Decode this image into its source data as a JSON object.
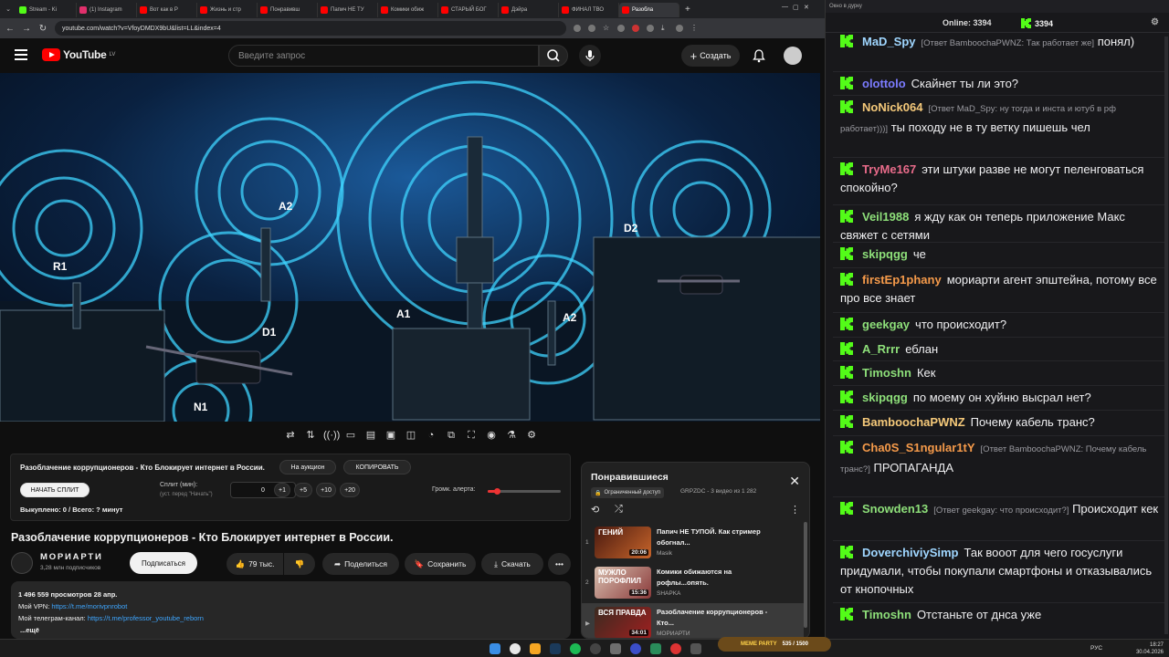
{
  "browser": {
    "tabs": [
      {
        "label": "Stream - Ki",
        "color": "#53fc18"
      },
      {
        "label": "(1) Instagram",
        "color": "#e1306c"
      },
      {
        "label": "Вот как в Р",
        "color": "#ff0000"
      },
      {
        "label": "Жизнь и стр",
        "color": "#ff0000"
      },
      {
        "label": "Понравивш",
        "color": "#ff0000"
      },
      {
        "label": "Папич НЕ ТУ",
        "color": "#ff0000"
      },
      {
        "label": "Комики обиж",
        "color": "#ff0000"
      },
      {
        "label": "СТАРЫЙ БОГ",
        "color": "#ff0000"
      },
      {
        "label": "Дэйра",
        "color": "#ff0000"
      },
      {
        "label": "ФИНАЛ ТВО",
        "color": "#ff0000"
      },
      {
        "label": "Разобла",
        "color": "#ff0000"
      }
    ],
    "url": "youtube.com/watch?v=VfoyDMDX9bU&list=LL&index=4"
  },
  "youtube": {
    "logo_text": "YouTube",
    "region": "LV",
    "search_placeholder": "Введите запрос",
    "create_label": "Создать",
    "video_labels": [
      "A2",
      "R1",
      "D1",
      "A1",
      "D2",
      "A2",
      "N1"
    ],
    "split_panel": {
      "title": "Разоблачение коррупционеров - Кто Блокирует интернет в России.",
      "auction_label": "На аукцион",
      "copy_label": "КОПИРОВАТЬ",
      "start_label": "НАЧАТЬ СПЛИТ",
      "split_label": "Сплит (мин):",
      "split_hint": "(уст. перед \"Начать\")",
      "split_value": "0",
      "increments": [
        "+1",
        "+5",
        "+10",
        "+20"
      ],
      "volume_label": "Громк. алерта:",
      "volume_level": 0.12,
      "status": "Выкуплено: 0 / Всего: ? минут"
    },
    "video_title": "Разоблачение коррупционеров - Кто Блокирует интернет в России.",
    "channel": {
      "name": "МОРИАРТИ",
      "subs": "3,28 млн подписчиков",
      "subscribe_label": "Подписаться"
    },
    "actions": {
      "likes": "79 тыс.",
      "share": "Поделиться",
      "save": "Сохранить",
      "download": "Скачать"
    },
    "description": {
      "stats": "1 496 559 просмотров  28 апр.",
      "vpn_label": "Мой VPN: ",
      "vpn_link": "https://t.me/morivpnrobot",
      "tg_label": "Мой телеграм-канал: ",
      "tg_link": "https://t.me/professor_youtube_reborn",
      "more": "...ещё"
    },
    "playlist": {
      "title": "Понравившиеся",
      "badge": "Ограниченный доступ",
      "meta": "GRPZDC - 3 видео из 1 282",
      "items": [
        {
          "num": "1",
          "thumb_text": "ГЕНИЙ",
          "duration": "20:06",
          "title": "Папич НЕ ТУПОЙ. Как стример обогнал...",
          "channel": "Masik"
        },
        {
          "num": "2",
          "thumb_text": "МУЖЛО ПОРОФЛИЛ",
          "duration": "15:36",
          "title": "Комики обижаются на рофлы...опять.",
          "channel": "SHAPKA"
        },
        {
          "num": "▶",
          "thumb_text": "ВСЯ ПРАВДА",
          "duration": "34:01",
          "title": "Разоблачение коррупционеров - Кто...",
          "channel": "МОРИАРТИ"
        }
      ]
    }
  },
  "chat": {
    "window_title": "Окно в дурку",
    "online_label": "Online:",
    "online_count": "3394",
    "viewer_count": "3394",
    "messages": [
      {
        "user": "MaD_Spy",
        "color": "#9fd6ff",
        "reply": "[Ответ BamboochaPWNZ: Так работает же]",
        "text": "понял)"
      },
      {
        "user": "olottolo",
        "color": "#7b7bff",
        "reply": "",
        "text": "Скайнет ты ли это?"
      },
      {
        "user": "NoNick064",
        "color": "#f5c97a",
        "reply": "[Ответ MaD_Spy: ну тогда и инста и ютуб в рф работает)))]",
        "text": "ты походу не в ту ветку пишешь чел"
      },
      {
        "user": "TryMe167",
        "color": "#e86b8a",
        "reply": "",
        "text": "эти штуки разве не могут пеленговаться спокойно?"
      },
      {
        "user": "Veil1988",
        "color": "#8ee07a",
        "reply": "",
        "text": "я жду как он теперь приложение Макс свяжет с сетями"
      },
      {
        "user": "skipqgg",
        "color": "#8ee07a",
        "reply": "",
        "text": "че"
      },
      {
        "user": "firstEp1phany",
        "color": "#f59a4a",
        "reply": "",
        "text": "мориарти агент эпштейна, потому все про все знает"
      },
      {
        "user": "geekgay",
        "color": "#8ee07a",
        "reply": "",
        "text": "что происходит?"
      },
      {
        "user": "A_Rrrr",
        "color": "#8ee07a",
        "reply": "",
        "text": "еблан"
      },
      {
        "user": "Timoshn",
        "color": "#8ee07a",
        "reply": "",
        "text": "Кек"
      },
      {
        "user": "skipqgg",
        "color": "#8ee07a",
        "reply": "",
        "text": "по моему он хуйню высрал нет?"
      },
      {
        "user": "BamboochaPWNZ",
        "color": "#f5c97a",
        "reply": "",
        "text": "Почему кабель транс?"
      },
      {
        "user": "Cha0S_S1ngular1tY",
        "color": "#f59a4a",
        "reply": "[Ответ BamboochaPWNZ: Почему кабель транс?]",
        "text": "ПРОПАГАНДА"
      },
      {
        "user": "Snowden13",
        "color": "#8ee07a",
        "reply": "[Ответ geekgay: что происходит?]",
        "text": "Происходит кек"
      },
      {
        "user": "DoverchiviySimp",
        "color": "#9fd6ff",
        "reply": "",
        "text": "Так вооот для чего госуслуги придумали, чтобы покупали смартфоны и отказывались от кнопочных"
      },
      {
        "user": "Timoshn",
        "color": "#8ee07a",
        "reply": "",
        "text": "Отстаньте от днса уже"
      }
    ]
  },
  "taskbar": {
    "meme_label": "MEME PARTY",
    "meme_progress": "535 / 1500",
    "lang": "РУС",
    "time": "18:27",
    "date": "30.04.2026"
  },
  "colors": {
    "kick_green": "#53fc18",
    "yt_red": "#ff0000",
    "accent_blue": "#3ea6ff"
  }
}
